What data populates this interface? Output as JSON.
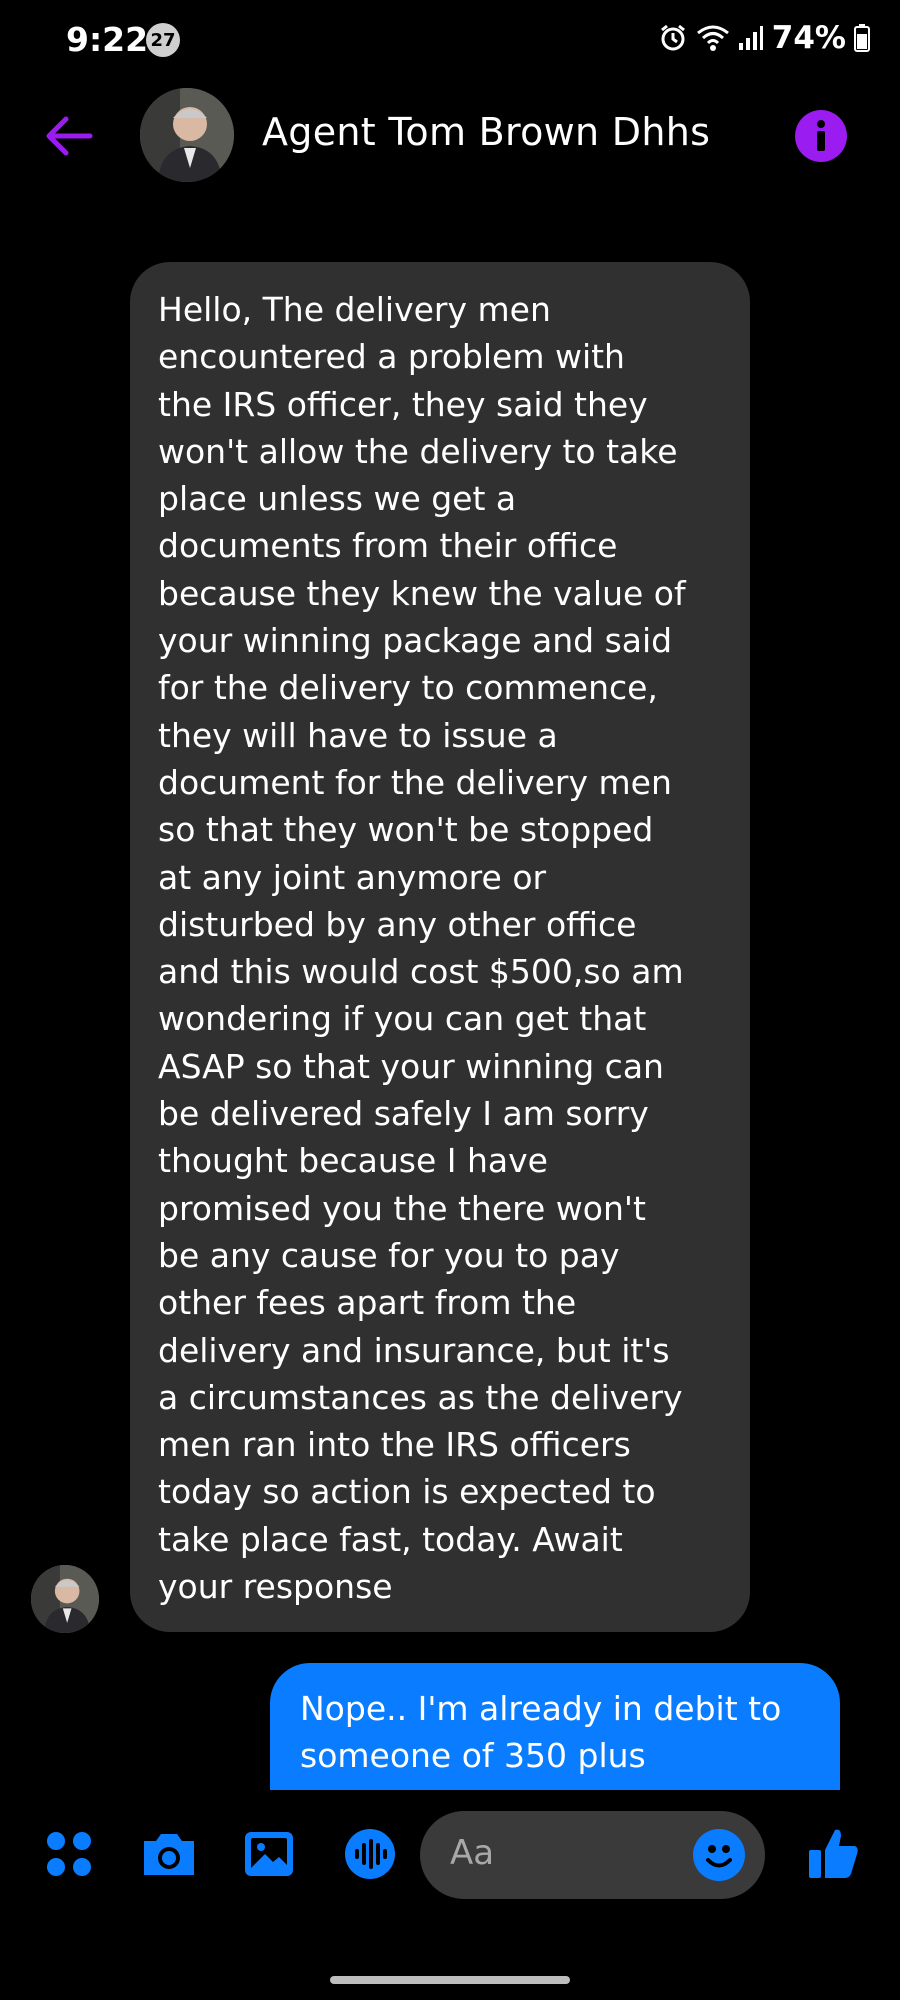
{
  "status_bar": {
    "time": "9:22",
    "notification_count": "27",
    "battery": "74%"
  },
  "header": {
    "contact_name": "Agent Tom Brown Dhhs"
  },
  "messages": [
    {
      "direction": "incoming",
      "text": "Hello, The delivery men\nencountered a problem with\nthe IRS officer, they said they\nwon't allow the delivery to take\nplace unless we get  a\ndocuments from their office\nbecause they knew the value of\nyour winning package and said\nfor the delivery to commence,\nthey will have to issue a\ndocument for the delivery men\nso that they won't be stopped\nat any joint anymore or\ndisturbed by any other office\nand this would cost $500,so am\nwondering if you can get that\nASAP so that your winning can\nbe delivered safely I am sorry\nthought because I have\npromised you the there won't\nbe any  cause for you to pay\nother fees apart from the\ndelivery and insurance, but it's\na circumstances as the delivery\nmen  ran into the IRS officers\ntoday so action is expected to\ntake place fast, today. Await\nyour response"
    },
    {
      "direction": "outgoing",
      "text": "Nope.. I'm already in debit to\nsomeone of 350 plus"
    }
  ],
  "composer": {
    "placeholder": "Aa"
  },
  "colors": {
    "accent_purple": "#9b1cf0",
    "messenger_blue": "#0a7cff",
    "incoming_bubble": "#303030"
  }
}
